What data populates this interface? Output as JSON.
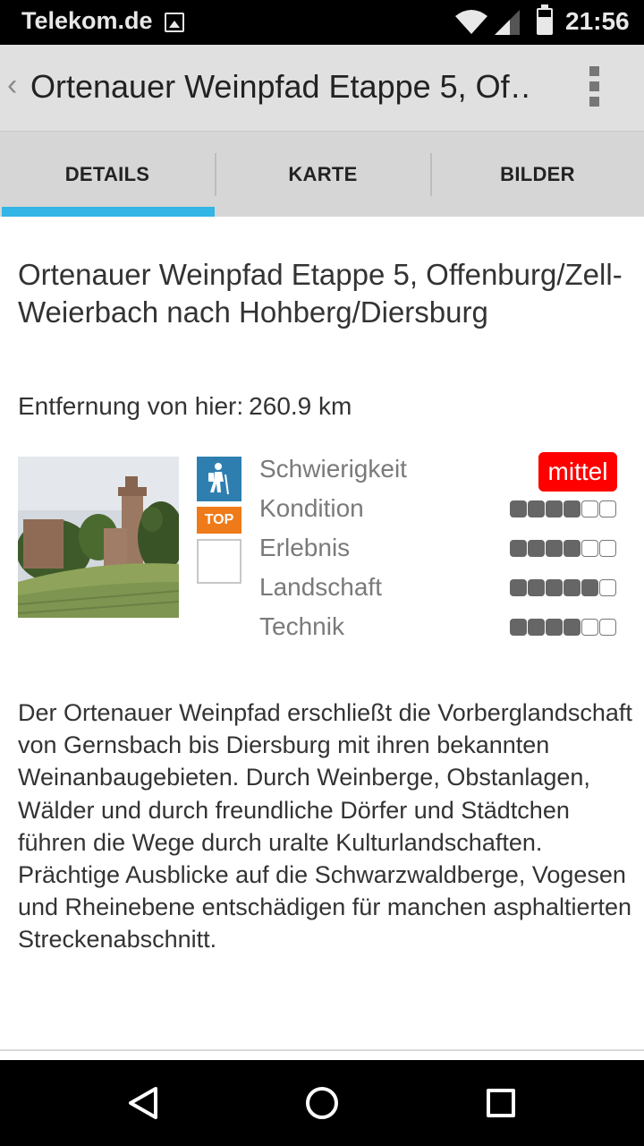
{
  "status_bar": {
    "carrier": "Telekom.de",
    "time": "21:56"
  },
  "action_bar": {
    "title": "Ortenauer Weinpfad Etappe 5, Of…"
  },
  "tabs": [
    {
      "label": "DETAILS",
      "selected": true
    },
    {
      "label": "KARTE",
      "selected": false
    },
    {
      "label": "BILDER",
      "selected": false
    }
  ],
  "details": {
    "title": "Ortenauer Weinpfad Etappe 5, Offenburg/Zell-Weierbach nach Hohberg/Diersburg",
    "distance_label": "Entfernung von hier:",
    "distance_value": "260.9 km",
    "badges": {
      "top_label": "TOP"
    },
    "ratings": [
      {
        "label": "Schwierigkeit",
        "value_text": "mittel"
      },
      {
        "label": "Kondition",
        "score": 4,
        "max": 6
      },
      {
        "label": "Erlebnis",
        "score": 4,
        "max": 6
      },
      {
        "label": "Landschaft",
        "score": 5,
        "max": 6
      },
      {
        "label": "Technik",
        "score": 4,
        "max": 6
      }
    ],
    "description": "Der Ortenauer Weinpfad erschließt die Vorberglandschaft von Gernsbach bis Diersburg mit ihren bekannten Weinanbaugebieten. Durch Weinberge, Obstanlagen, Wälder und durch freundliche Dörfer und Städtchen führen die Wege durch uralte Kulturlandschaften. Prächtige Ausblicke auf die Schwarzwaldberge, Vogesen und Rheinebene entschädigen für manchen asphaltierten Streckenabschnitt."
  },
  "colors": {
    "tab_indicator": "#33b5e5",
    "difficulty_badge": "#ff0000",
    "hike_badge": "#2e7fb0",
    "top_badge": "#ef7a1a"
  },
  "icons": {
    "status": [
      "gallery-icon",
      "wifi-icon",
      "signal-icon",
      "battery-icon"
    ],
    "action_bar": [
      "back-chevron-icon",
      "overflow-menu-icon"
    ],
    "badges": [
      "hiking-icon"
    ],
    "nav": [
      "back-icon",
      "home-icon",
      "recents-icon"
    ]
  }
}
